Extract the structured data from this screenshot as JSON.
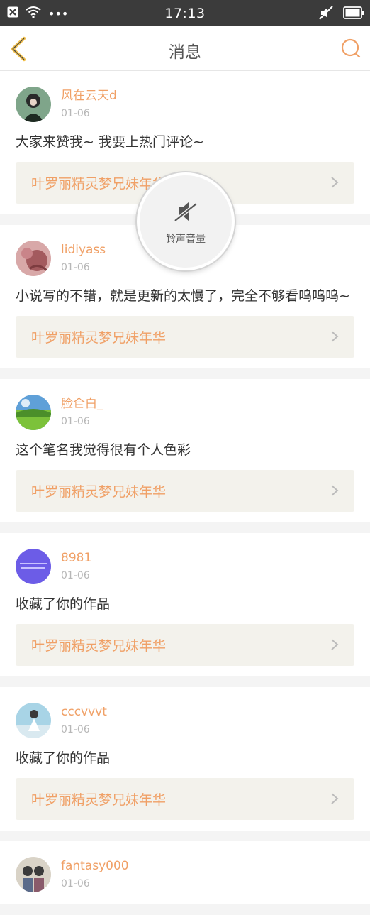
{
  "status_bar": {
    "time": "17:13",
    "dots": "•••"
  },
  "header": {
    "title": "消息"
  },
  "messages": [
    {
      "username": "风在云天d",
      "date": "01-06",
      "comment": "大家来赞我~ 我要上热门评论~",
      "book": "叶罗丽精灵梦兄妹年华"
    },
    {
      "username": "lidiyass",
      "date": "01-06",
      "comment": "小说写的不错，就是更新的太慢了，完全不够看呜呜呜~",
      "book": "叶罗丽精灵梦兄妹年华"
    },
    {
      "username": "脸仺白_",
      "date": "01-06",
      "comment": "这个笔名我觉得很有个人色彩",
      "book": "叶罗丽精灵梦兄妹年华"
    },
    {
      "username": "8981",
      "date": "01-06",
      "comment": "收藏了你的作品",
      "book": "叶罗丽精灵梦兄妹年华"
    },
    {
      "username": "cccvvvt",
      "date": "01-06",
      "comment": "收藏了你的作品",
      "book": "叶罗丽精灵梦兄妹年华"
    },
    {
      "username": "fantasy000",
      "date": "01-06"
    }
  ],
  "volume_toast": {
    "label": "铃声音量",
    "icon": "speaker-muted-icon"
  },
  "colors": {
    "accent": "#f0a066",
    "status_bar": "#3b3b3b",
    "link_bg": "#f3f2ec"
  }
}
